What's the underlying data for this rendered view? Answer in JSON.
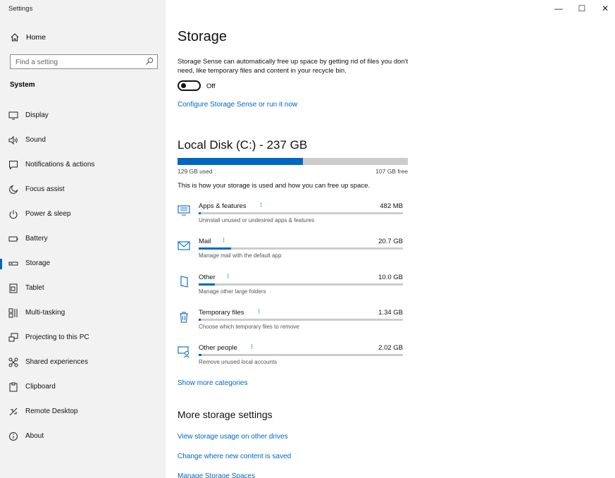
{
  "window": {
    "title": "Settings",
    "minimize": "—",
    "maximize": "☐",
    "close": "✕"
  },
  "sidebar": {
    "home_label": "Home",
    "search_placeholder": "Find a setting",
    "section_label": "System",
    "items": [
      {
        "label": "Display",
        "icon": "monitor-icon",
        "selected": false
      },
      {
        "label": "Sound",
        "icon": "speaker-icon",
        "selected": false
      },
      {
        "label": "Notifications & actions",
        "icon": "notification-icon",
        "selected": false
      },
      {
        "label": "Focus assist",
        "icon": "moon-icon",
        "selected": false
      },
      {
        "label": "Power & sleep",
        "icon": "power-icon",
        "selected": false
      },
      {
        "label": "Battery",
        "icon": "battery-icon",
        "selected": false
      },
      {
        "label": "Storage",
        "icon": "storage-icon",
        "selected": true
      },
      {
        "label": "Tablet",
        "icon": "tablet-icon",
        "selected": false
      },
      {
        "label": "Multi-tasking",
        "icon": "multitasking-icon",
        "selected": false
      },
      {
        "label": "Projecting to this PC",
        "icon": "projecting-icon",
        "selected": false
      },
      {
        "label": "Shared experiences",
        "icon": "shared-icon",
        "selected": false
      },
      {
        "label": "Clipboard",
        "icon": "clipboard-icon",
        "selected": false
      },
      {
        "label": "Remote Desktop",
        "icon": "remote-desktop-icon",
        "selected": false
      },
      {
        "label": "About",
        "icon": "info-icon",
        "selected": false
      }
    ]
  },
  "main": {
    "title": "Storage",
    "description": "Storage Sense can automatically free up space by getting rid of files you don't need, like temporary files and content in your recycle bin.",
    "toggle_state": "Off",
    "configure_link": "Configure Storage Sense or run it now",
    "disk": {
      "title": "Local Disk (C:) - 237 GB",
      "used": "129 GB used",
      "free": "107 GB free",
      "used_fraction": 0.545,
      "explanation": "This is how your storage is used and how you can free up space."
    },
    "categories": [
      {
        "name": "Apps & features",
        "size": "482 MB",
        "description": "Uninstall unused or undesired apps & features",
        "icon": "apps-icon",
        "fraction": 0.0
      },
      {
        "name": "Mail",
        "size": "20.7 GB",
        "description": "Manage mail with the default app",
        "icon": "mail-icon",
        "fraction": 0.16
      },
      {
        "name": "Other",
        "size": "10.0 GB",
        "description": "Manage other large folders",
        "icon": "folder-icon",
        "fraction": 0.08
      },
      {
        "name": "Temporary files",
        "size": "1.34 GB",
        "description": "Choose which temporary files to remove",
        "icon": "trash-icon",
        "fraction": 0.01
      },
      {
        "name": "Other people",
        "size": "2.02 GB",
        "description": "Remove unused local accounts",
        "icon": "people-icon",
        "fraction": 0.015
      }
    ],
    "show_more": "Show more categories",
    "more_title": "More storage settings",
    "more_links": [
      "View storage usage on other drives",
      "Change where new content is saved",
      "Manage Storage Spaces"
    ]
  },
  "colors": {
    "accent": "#0067c0",
    "sidebar_bg": "#f2f2f2",
    "bar_track": "#cccccc"
  }
}
